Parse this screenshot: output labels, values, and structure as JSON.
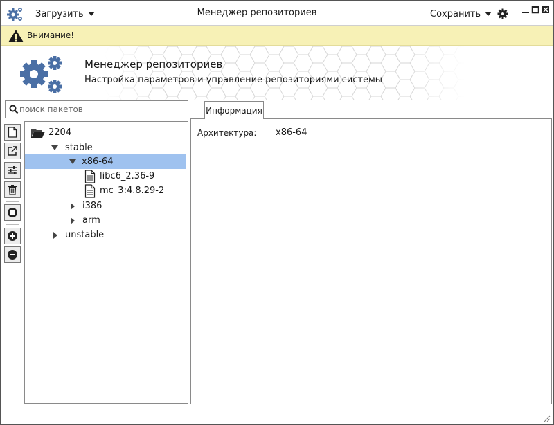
{
  "window": {
    "title": "Менеджер репозиториев",
    "load_menu": "Загрузить",
    "save_menu": "Сохранить"
  },
  "warning": {
    "text": "Внимание!"
  },
  "header": {
    "title": "Менеджер репозиториев",
    "subtitle": "Настройка параметров и управление репозиториями системы"
  },
  "search": {
    "placeholder": "поиск пакетов"
  },
  "tree": {
    "root": "2204",
    "stable": "stable",
    "x86": "x86-64",
    "pkg1": "libc6_2.36-9",
    "pkg2": "mc_3:4.8.29-2",
    "i386": "i386",
    "arm": "arm",
    "unstable": "unstable"
  },
  "info": {
    "tab": "Информация",
    "arch_label": "Архитектура:",
    "arch_value": "x86-64"
  },
  "colors": {
    "accent": "#4a6fa5",
    "selection": "#9fc2ef",
    "warning_bg": "#f7f1b6"
  },
  "icons": {
    "app": "gears-icon",
    "settings": "gear-icon",
    "warning": "warning-triangle-icon",
    "search": "search-icon",
    "toolbar": [
      "new-file-icon",
      "open-external-icon",
      "sliders-icon",
      "trash-icon",
      "stop-icon",
      "add-icon",
      "remove-icon"
    ]
  }
}
